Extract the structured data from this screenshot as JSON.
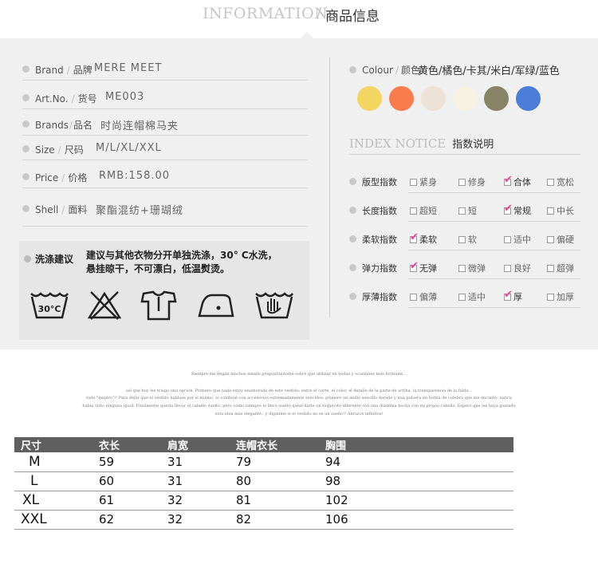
{
  "header": {
    "title_en": "INFORMATION",
    "separator": "/",
    "title_cn": "商品信息"
  },
  "info": [
    {
      "label_en": "Brand",
      "label_cn": "品牌",
      "value": "MERE MEET"
    },
    {
      "label_en": "Art.No.",
      "label_cn": "货号",
      "value": "ME003"
    },
    {
      "label_en": "Brands",
      "label_cn": "品名",
      "value": "时尚连帽棉马夹"
    },
    {
      "label_en": "Size",
      "label_cn": "尺码",
      "value": "M/L/XL/XXL"
    },
    {
      "label_en": "Price",
      "label_cn": "价格",
      "value": "RMB:158.00"
    },
    {
      "label_en": "Shell",
      "label_cn": "面料",
      "value": "聚酯混纺+珊瑚绒"
    }
  ],
  "wash": {
    "title": "洗涤建议",
    "line1": "建议与其他衣物分开单独洗涤，30° C水洗，",
    "line2": "悬挂晾干，不可漂白，低温熨烫。",
    "icons": [
      "wash-30c-icon",
      "no-bleach-icon",
      "hang-dry-icon",
      "iron-low-icon",
      "hand-wash-icon"
    ],
    "temp": "30°C"
  },
  "colour": {
    "label_en": "Colour",
    "label_cn": "颜色",
    "values": "黄色/橘色/卡其/米白/军绿/蓝色",
    "swatches": [
      "#f3d561",
      "#f97c4e",
      "#ede2d8",
      "#f6f1e0",
      "#868366",
      "#4c7ed9"
    ]
  },
  "index": {
    "title_en": "INDEX NOTICE",
    "title_cn": "指数说明",
    "rows": [
      {
        "label": "版型指数",
        "options": [
          "紧身",
          "修身",
          "合体",
          "宽松"
        ],
        "checked": 2
      },
      {
        "label": "长度指数",
        "options": [
          "超短",
          "短",
          "常规",
          "中长"
        ],
        "checked": 2
      },
      {
        "label": "柔软指数",
        "options": [
          "柔软",
          "软",
          "适中",
          "偏硬"
        ],
        "checked": 0
      },
      {
        "label": "弹力指数",
        "options": [
          "无弹",
          "微弹",
          "良好",
          "超弹"
        ],
        "checked": 0
      },
      {
        "label": "厚薄指数",
        "options": [
          "偏薄",
          "适中",
          "厚",
          "加厚"
        ],
        "checked": 2
      }
    ]
  },
  "paragraph": {
    "line1": "Siempre me llegan muchos emails preguntándome sobre que utilizar en bodas y ocasiones más formales...",
    "line2": "así que hoy les traigo una opción. Primero que nada estoy enamorada de este vestido: entre el corte, el color, el detalle de la parte de arriba, la transparencia de la falda...",
    "line3": "todo \"inspiro\"!! Para dejar que el vestido hablase por sí mismo, lo combiné con accesorios extremadamente sencillos: primero un anillo sencillo dorado y una pulsera en forma de culebra que me encantó- nunca",
    "line4": "había visto ninguna igual. Finalmente quería llevar el cabello suelto, pero como siempre lo llevo suelto quise darle un toquecito diferente con una diadema hecha con mi propio cabello. Espero que les haya gustado",
    "line5": "esta idea más elegante.. y díganme si el vestido no es un sueño!! Abrazos infinitos!"
  },
  "size_table": {
    "headers": [
      "尺寸",
      "衣长",
      "肩宽",
      "连帽衣长",
      "胸围"
    ],
    "rows": [
      [
        "M",
        "59",
        "31",
        "79",
        "94"
      ],
      [
        "L",
        "60",
        "31",
        "80",
        "98"
      ],
      [
        "XL",
        "61",
        "32",
        "81",
        "102"
      ],
      [
        "XXL",
        "62",
        "32",
        "82",
        "106"
      ]
    ]
  }
}
